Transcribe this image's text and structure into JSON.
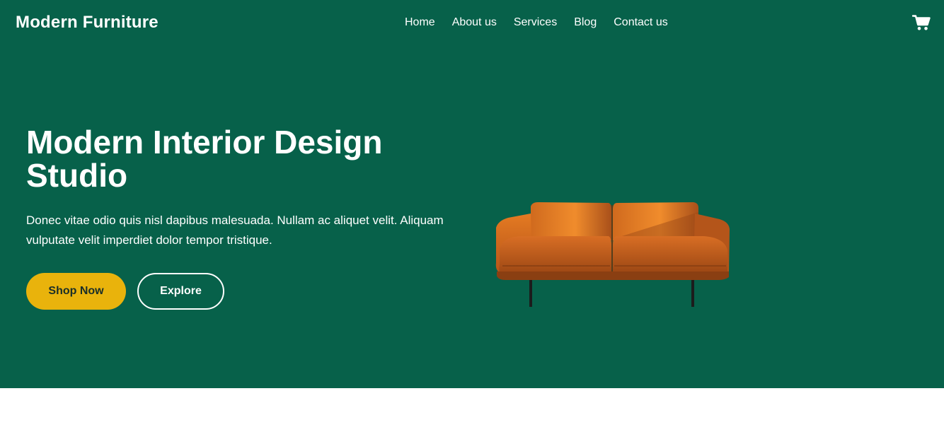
{
  "brand": {
    "name": "Modern Furniture"
  },
  "nav": {
    "items": [
      {
        "label": "Home"
      },
      {
        "label": "About us"
      },
      {
        "label": "Services"
      },
      {
        "label": "Blog"
      },
      {
        "label": "Contact us"
      }
    ]
  },
  "header": {
    "cart_icon": "cart-icon"
  },
  "hero": {
    "title": "Modern Interior Design Studio",
    "description": "Donec vitae odio quis nisl dapibus malesuada. Nullam ac aliquet velit. Aliquam vulputate velit imperdiet dolor tempor tristique.",
    "primary_button": "Shop Now",
    "secondary_button": "Explore",
    "image": "orange-leather-sofa"
  },
  "colors": {
    "hero_background": "#07614a",
    "accent": "#e9b30c",
    "text": "#ffffff"
  }
}
